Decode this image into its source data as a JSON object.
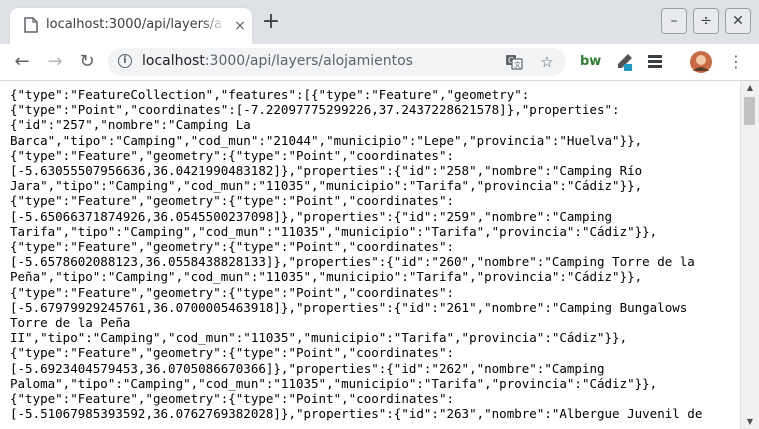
{
  "browser": {
    "tab": {
      "title": "localhost:3000/api/layers/alojamientos",
      "close_glyph": "×",
      "favicon": "page-icon"
    },
    "new_tab_glyph": "+",
    "window_controls": {
      "minimize": "–",
      "maximize": "÷",
      "close": "✕"
    },
    "nav": {
      "back": "←",
      "forward": "→",
      "reload": "↻"
    },
    "omnibox": {
      "host": "localhost",
      "path": ":3000/api/layers/alojamientos",
      "info_glyph": "i",
      "translate_icon": "translate-icon",
      "bookmark_glyph": "☆"
    },
    "extensions": {
      "bw_label": "bw",
      "eyedropper": "eyedropper-icon",
      "list": "list-icon",
      "avatar": "avatar"
    }
  },
  "content": {
    "lines": [
      "{\"type\":\"FeatureCollection\",\"features\":[{\"type\":\"Feature\",\"geometry\":",
      "{\"type\":\"Point\",\"coordinates\":[-7.22097775299226,37.2437228621578]},\"properties\":",
      "{\"id\":\"257\",\"nombre\":\"Camping La",
      "Barca\",\"tipo\":\"Camping\",\"cod_mun\":\"21044\",\"municipio\":\"Lepe\",\"provincia\":\"Huelva\"}},",
      "{\"type\":\"Feature\",\"geometry\":{\"type\":\"Point\",\"coordinates\":",
      "[-5.63055507956636,36.0421990483182]},\"properties\":{\"id\":\"258\",\"nombre\":\"Camping Río",
      "Jara\",\"tipo\":\"Camping\",\"cod_mun\":\"11035\",\"municipio\":\"Tarifa\",\"provincia\":\"Cádiz\"}},",
      "{\"type\":\"Feature\",\"geometry\":{\"type\":\"Point\",\"coordinates\":",
      "[-5.65066371874926,36.0545500237098]},\"properties\":{\"id\":\"259\",\"nombre\":\"Camping",
      "Tarifa\",\"tipo\":\"Camping\",\"cod_mun\":\"11035\",\"municipio\":\"Tarifa\",\"provincia\":\"Cádiz\"}},",
      "{\"type\":\"Feature\",\"geometry\":{\"type\":\"Point\",\"coordinates\":",
      "[-5.6578602088123,36.0558438828133]},\"properties\":{\"id\":\"260\",\"nombre\":\"Camping Torre de la",
      "Peña\",\"tipo\":\"Camping\",\"cod_mun\":\"11035\",\"municipio\":\"Tarifa\",\"provincia\":\"Cádiz\"}},",
      "{\"type\":\"Feature\",\"geometry\":{\"type\":\"Point\",\"coordinates\":",
      "[-5.67979929245761,36.0700005463918]},\"properties\":{\"id\":\"261\",\"nombre\":\"Camping Bungalows",
      "Torre de la Peña",
      "II\",\"tipo\":\"Camping\",\"cod_mun\":\"11035\",\"municipio\":\"Tarifa\",\"provincia\":\"Cádiz\"}},",
      "{\"type\":\"Feature\",\"geometry\":{\"type\":\"Point\",\"coordinates\":",
      "[-5.6923404579453,36.0705086670366]},\"properties\":{\"id\":\"262\",\"nombre\":\"Camping",
      "Paloma\",\"tipo\":\"Camping\",\"cod_mun\":\"11035\",\"municipio\":\"Tarifa\",\"provincia\":\"Cádiz\"}},",
      "{\"type\":\"Feature\",\"geometry\":{\"type\":\"Point\",\"coordinates\":",
      "[-5.51067985393592,36.0762769382028]},\"properties\":{\"id\":\"263\",\"nombre\":\"Albergue Juvenil de"
    ]
  },
  "scrollbar": {
    "up_glyph": "▲",
    "down_glyph": "▼"
  }
}
